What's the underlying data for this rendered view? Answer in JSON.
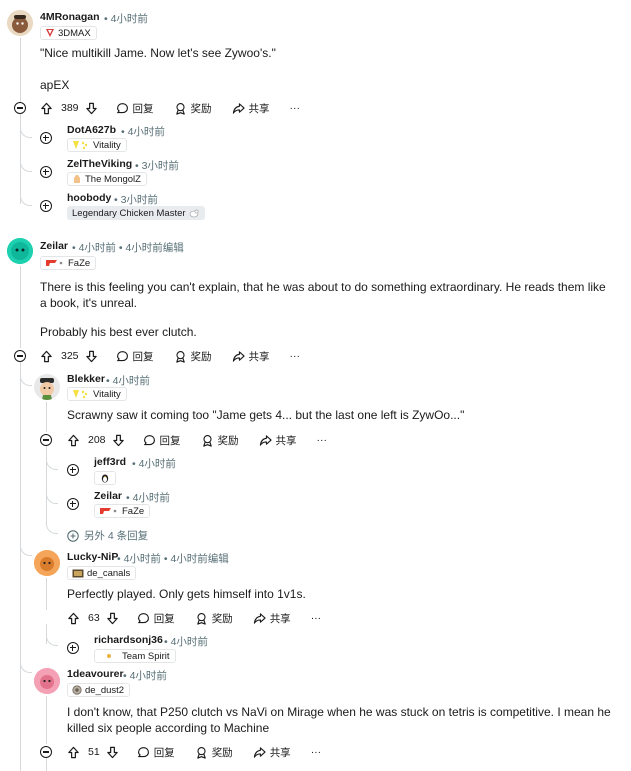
{
  "comments": {
    "c1": {
      "user": "4MRonagan",
      "time": "• 4小时前",
      "flair": "3DMAX",
      "body": [
        "\"Nice multikill Jame. Now let's see Zywoo's.\"",
        "apEX"
      ],
      "votes": "389",
      "reply": "回复",
      "award": "奖励",
      "share": "共享",
      "more": "···"
    },
    "c1_replies": [
      {
        "user": "DotA627b",
        "time": "• 4小时前",
        "flair": "Vitality"
      },
      {
        "user": "ZelTheViking",
        "time": "• 3小时前",
        "flair": "The MongolZ"
      },
      {
        "user": "hoobody",
        "time": "• 3小时前",
        "flair": "Legendary Chicken Master"
      }
    ],
    "c2": {
      "user": "Zeilar",
      "time": "• 4小时前 • 4小时前编辑",
      "flair": "FaZe",
      "body": [
        "There is this feeling you can't explain, that he was about to do something extraordinary. He reads them like a book, it's unreal.",
        "Probably his best ever clutch."
      ],
      "votes": "325",
      "reply": "回复",
      "award": "奖励",
      "share": "共享",
      "more": "···"
    },
    "c3": {
      "user": "Blekker",
      "time": "• 4小时前",
      "flair": "Vitality",
      "body": "Scrawny saw it coming too \"Jame gets 4... but the last one left is ZywOo...\"",
      "votes": "208",
      "reply": "回复",
      "award": "奖励",
      "share": "共享",
      "more": "···"
    },
    "c3_replies": [
      {
        "user": "jeff3rd",
        "time": "• 4小时前",
        "flair": ""
      },
      {
        "user": "Zeilar",
        "time": "• 4小时前",
        "flair": "FaZe"
      }
    ],
    "c3_more": "另外 4 条回复",
    "c4": {
      "user": "Lucky-NiP",
      "time": "• 4小时前 • 4小时前编辑",
      "flair": "de_canals",
      "body": "Perfectly played. Only gets himself into 1v1s.",
      "votes": "63",
      "reply": "回复",
      "award": "奖励",
      "share": "共享",
      "more": "···"
    },
    "c4_replies": [
      {
        "user": "richardsonj36",
        "time": "• 4小时前",
        "flair": "Team Spirit"
      }
    ],
    "c5": {
      "user": "1deavourer",
      "time": "• 4小时前",
      "flair": "de_dust2",
      "body": "I don't know, that P250 clutch vs NaVi on Mirage when he was stuck on tetris is competitive. I mean he killed six people according to Machine",
      "votes": "51",
      "reply": "回复",
      "award": "奖励",
      "share": "共享",
      "more": "···"
    }
  },
  "colors": {
    "line": "#d5d9dc",
    "meta": "#576f76",
    "text": "#1a1a1b",
    "faze": "#e43d30",
    "vitality": "#f5e042"
  },
  "icons": [
    "upvote-icon",
    "downvote-icon",
    "comment-icon",
    "award-icon",
    "share-icon",
    "collapse-icon",
    "expand-icon"
  ]
}
